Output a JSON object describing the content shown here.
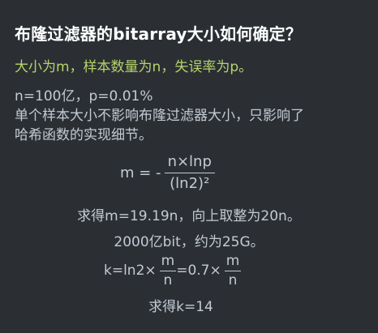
{
  "title": "布隆过滤器的bitarray大小如何确定？",
  "subtitle": "大小为m，样本数量为n，失误率为p。",
  "lines": [
    "n=100亿，p=0.01%",
    "单个样本大小不影响布隆过滤器大小，只影响了",
    "哈希函数的实现细节。"
  ],
  "formula_m": {
    "lhs": "m = -",
    "numerator": "n×lnp",
    "denominator": "(ln2)²"
  },
  "result_m": "求得m=19.19n，向上取整为20n。",
  "result_bits": "2000亿bit，约为25G。",
  "formula_k": {
    "lhs": "k=ln2×",
    "frac1_num": "m",
    "frac1_den": "n",
    "mid": "=0.7×",
    "frac2_num": "m",
    "frac2_den": "n"
  },
  "result_k": "求得k=14"
}
